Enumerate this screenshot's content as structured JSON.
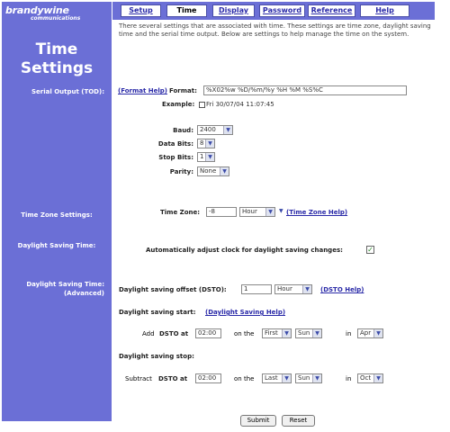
{
  "logo": {
    "line1": "brandywine",
    "line2": "communications"
  },
  "sidebar": {
    "title1": "Time",
    "title2": "Settings",
    "serial_output": "Serial Output (TOD):",
    "time_zone_settings": "Time Zone Settings:",
    "dst": "Daylight Saving Time:",
    "dst_adv1": "Daylight Saving Time:",
    "dst_adv2": "(Advanced)"
  },
  "nav": {
    "setup": "Setup",
    "time": "Time",
    "display": "Display",
    "password": "Password",
    "reference": "Reference",
    "help": "Help"
  },
  "intro": "There several settings that are associated with time. These settings are time zone, daylight saving time and the serial time output. Below are settings to help manage the time on the system.",
  "serial": {
    "format_help": "(Format Help)",
    "format_label": "Format:",
    "format_value": "%X02%w %D/%m/%y  %H %M %S%C",
    "example_label": "Example:",
    "example_value": "Fri 30/07/04 11:07:45",
    "baud_label": "Baud:",
    "baud_value": "2400",
    "data_bits_label": "Data Bits:",
    "data_bits_value": "8",
    "stop_bits_label": "Stop Bits:",
    "stop_bits_value": "1",
    "parity_label": "Parity:",
    "parity_value": "None"
  },
  "timezone": {
    "label": "Time Zone:",
    "value": "-8",
    "unit": "Hour",
    "help": "(Time Zone Help)"
  },
  "dst": {
    "auto_label": "Automatically adjust clock for daylight saving changes:",
    "auto_checked": true
  },
  "advanced": {
    "offset_label": "Daylight saving offset (DSTO):",
    "offset_value": "1",
    "offset_unit": "Hour",
    "offset_help": "(DSTO Help)",
    "start_label": "Daylight saving start:",
    "start_help": "(Daylight Saving Help)",
    "start_add": "Add",
    "start_dsto_at": "DSTO at",
    "start_time": "02:00",
    "start_on_the": "on the",
    "start_week": "First",
    "start_day": "Sun",
    "start_in": "in",
    "start_month": "Apr",
    "stop_label": "Daylight saving stop:",
    "stop_subtract": "Subtract",
    "stop_dsto_at": "DSTO at",
    "stop_time": "02:00",
    "stop_on_the": "on the",
    "stop_week": "Last",
    "stop_day": "Sun",
    "stop_in": "in",
    "stop_month": "Oct"
  },
  "buttons": {
    "submit": "Submit",
    "reset": "Reset"
  },
  "colors": {
    "sidebar": "#6b6fd6",
    "link": "#2a2aa8",
    "check": "#2a8a2a"
  }
}
